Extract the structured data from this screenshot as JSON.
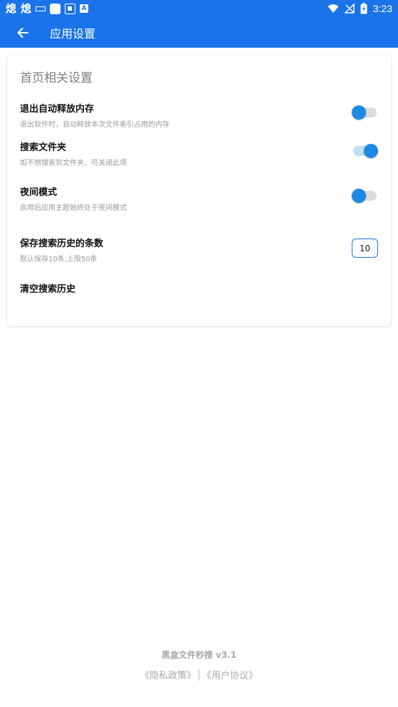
{
  "status_bar": {
    "left_glyphs": [
      "熄",
      "熄"
    ],
    "time": "3:23",
    "icons": [
      "keyboard-icon",
      "square-icon",
      "qr-icon",
      "a-icon",
      "wifi-icon",
      "no-signal-icon",
      "battery-charging-icon"
    ]
  },
  "app_bar": {
    "back_icon": "arrow-left-icon",
    "title": "应用设置",
    "color": "#1a73e8"
  },
  "settings": {
    "section_title": "首页相关设置",
    "items": [
      {
        "title": "退出自动释放内存",
        "desc": "退出软件时，自动释放本次文件索引占用的内存",
        "control": "toggle",
        "on": false
      },
      {
        "title": "搜索文件夹",
        "desc": "如不想搜索到文件夹，可关闭此项",
        "control": "toggle",
        "on": true
      },
      {
        "title": "夜间模式",
        "desc": "启用后应用主题始终处于夜间模式",
        "control": "toggle",
        "on": false
      },
      {
        "title": "保存搜索历史的条数",
        "desc": "默认保存10条,上限50条",
        "control": "number",
        "value": "10"
      },
      {
        "title": "清空搜索历史",
        "desc": "",
        "control": "none"
      }
    ]
  },
  "footer": {
    "app_name": "黑盒文件秒搜 v3.1",
    "privacy_link": "《隐私政策》",
    "terms_link": "《用户协议》"
  }
}
